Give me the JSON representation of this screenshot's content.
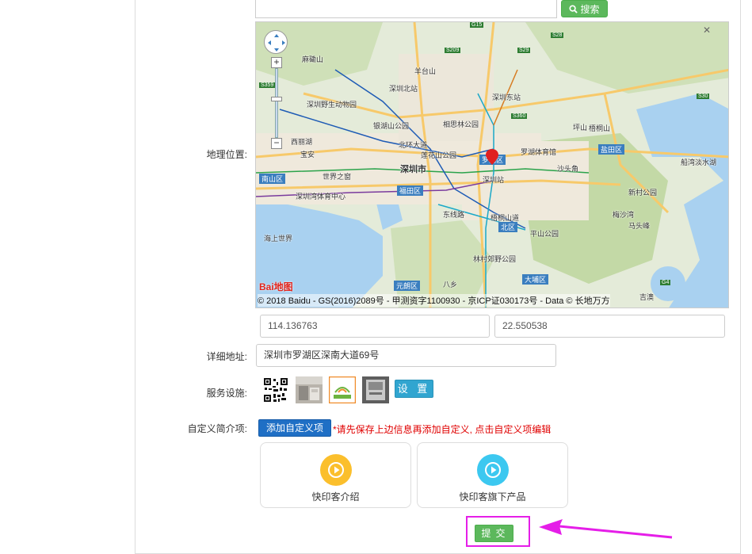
{
  "search": {
    "button_label": "搜索",
    "icon": "search-icon"
  },
  "map": {
    "labels": {
      "mahanling": "麻磡山",
      "pingshan": "坪山",
      "yangtaishan": "羊台山",
      "shenzhenbei": "深圳北站",
      "wildlife_park": "深圳野生动物园",
      "yinhu": "银湖山公园",
      "xiangmi": "相思林公园",
      "shenzhendong": "深圳东站",
      "xili": "西丽湖",
      "beihuan": "北环大道",
      "lianhua": "莲花山公园",
      "nanshan": "南山区",
      "futian": "福田区",
      "luohu": "罗湖区",
      "shenzhenshi": "深圳市",
      "shenzhenzhan": "深圳站",
      "luohu_museum": "罗湖体育馆",
      "yantian": "盐田区",
      "meishacheng": "梅沙湾",
      "wutongshan": "梧桐山",
      "shijiezhichuang": "世界之窗",
      "binhai": "深圳湾体育中心",
      "dongshan": "东线路",
      "nvhe": "梧桐山道",
      "fenglin": "新村公园",
      "lingshan": "林村郊野公园",
      "haishang": "海上世界",
      "yuanlang": "元朗区",
      "datong": "大埔区",
      "beiqu": "北区",
      "bayue": "八乡",
      "pingshan2": "平山公园",
      "maanshan": "马头峰",
      "chuanjia": "船湾淡水湖",
      "jishan": "吉澳",
      "baoan": "宝安",
      "shaotou": "沙头角"
    },
    "road_chips": [
      "G15",
      "S209",
      "S28",
      "S359",
      "S360",
      "S30",
      "S29",
      "G4"
    ],
    "copyright": "© 2018 Baidu - GS(2016)2089号 - 甲测资字1100930 - 京ICP证030173号 - Data © 长地万方",
    "logo_text": "Bai地图",
    "close_glyph": "✕"
  },
  "location": {
    "label": "地理位置:",
    "longitude": "114.136763",
    "latitude": "22.550538"
  },
  "address": {
    "label": "详细地址:",
    "value": "深圳市罗湖区深南大道69号"
  },
  "facilities": {
    "label": "服务设施:",
    "set_button": "设 置"
  },
  "custom": {
    "label": "自定义简介项:",
    "add_button": "添加自定义项",
    "hint": "*请先保存上边信息再添加自定义, 点击自定义项编辑",
    "cards": [
      {
        "title": "快印客介绍",
        "color": "#fbbf2c"
      },
      {
        "title": "快印客旗下产品",
        "color": "#3cc8f0"
      }
    ]
  },
  "submit": {
    "label": "提交"
  },
  "colors": {
    "green": "#5cb85c",
    "blue": "#1f6fc5",
    "red": "#e00000",
    "highlight": "#e51ee8"
  }
}
